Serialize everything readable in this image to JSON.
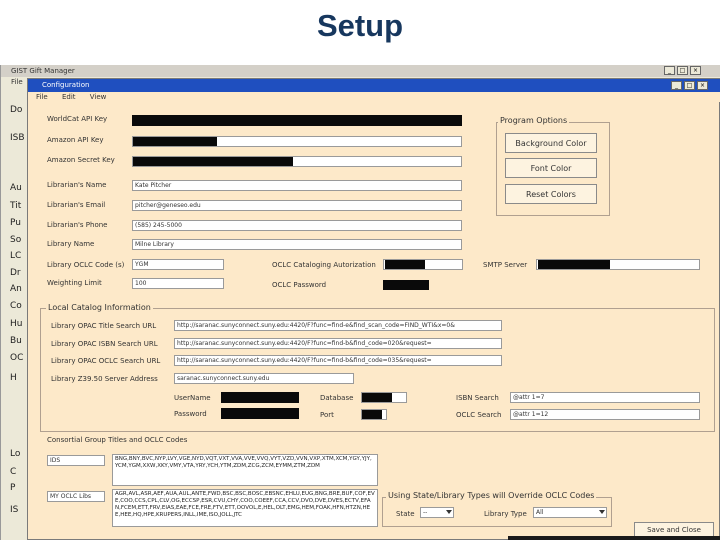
{
  "slide": {
    "title": "Setup"
  },
  "main_window": {
    "title": "GIST Gift Manager",
    "menu": [
      "File"
    ],
    "left_labels": [
      "Do",
      "ISB",
      "Au",
      "Tit",
      "Pu",
      "So",
      "LC",
      "Dr",
      "An",
      "Co",
      "Hu",
      "Bu",
      "OC",
      "H",
      "Lo",
      "C",
      "P",
      "IS"
    ]
  },
  "dialog": {
    "title": "Configuration",
    "menu": [
      "File",
      "Edit",
      "View"
    ],
    "fields": {
      "worldcat_api_key": "WorldCat API Key",
      "amazon_api_key": "Amazon API Key",
      "amazon_secret_key": "Amazon Secret Key",
      "librarian_name_label": "Librarian's Name",
      "librarian_name_value": "Kate Pitcher",
      "librarian_email_label": "Librarian's Email",
      "librarian_email_value": "pitcher@geneseo.edu",
      "librarian_phone_label": "Librarian's Phone",
      "librarian_phone_value": "(585) 245-5000",
      "library_name_label": "Library Name",
      "library_name_value": "Milne Library",
      "oclc_code_label": "Library OCLC Code (s)",
      "oclc_code_value": "YGM",
      "weighting_limit_label": "Weighting Limit",
      "weighting_limit_value": "100",
      "oclc_auth_label": "OCLC Cataloging Autorization",
      "oclc_password_label": "OCLC Password",
      "smtp_server_label": "SMTP Server"
    },
    "program_options": {
      "title": "Program Options",
      "background_color": "Background Color",
      "font_color": "Font Color",
      "reset_colors": "Reset Colors"
    },
    "local_catalog": {
      "title": "Local Catalog Information",
      "title_search_label": "Library OPAC Title Search URL",
      "title_search_value": "http://saranac.sunyconnect.suny.edu:4420/F?func=find-e&find_scan_code=FIND_WTI&x=0&",
      "isbn_search_label": "Library OPAC ISBN Search URL",
      "isbn_search_value": "http://saranac.sunyconnect.suny.edu:4420/F?func=find-b&find_code=020&request=",
      "oclc_search_label": "Library OPAC OCLC Search URL",
      "oclc_search_value": "http://saranac.sunyconnect.suny.edu:4420/F?func=find-b&find_code=035&request=",
      "z3950_label": "Library Z39.50 Server Address",
      "z3950_value": "saranac.sunyconnect.suny.edu",
      "username_label": "UserName",
      "password_label": "Password",
      "database_label": "Database",
      "port_label": "Port",
      "isbn_search_z_label": "ISBN Search",
      "isbn_search_z_value": "@attr 1=7",
      "oclc_search_z_label": "OCLC Search",
      "oclc_search_z_value": "@attr 1=12"
    },
    "consortial": {
      "title": "Consortial Group Titles and OCLC Codes",
      "group1_name": "IDS",
      "group1_codes": "BNG,BNY,BVC,NYP,LVY,VGE,NYD,VQT,VXT,VVA,VVE,VVQ,VYT,VZD,VVN,VXP,XTM,XCM,YGY,YJY,YCM,YGM,XXW,XKY,VMY,VTA,YRY,YCH,YTM,ZDM,ZCG,ZCM,EYMM,ZTM,ZDM",
      "group2_name": "MY OCLC Libs",
      "group2_codes": "AGR,AVL,ASR,AEF,AUA,AUL,ANTE,FWD,BSC,BSC,BOSC,EBSNC,EHLU,EUG,BNG,BRE,BUF,COF,EVE,COO,CCS,CPL,CLV,OG,ECCSP,ESR,CVU,CHY,COO,COEEF,CCA,CCV,DVO,DVE,DVES,ECTV,EFAN,FCEM,ETT,FRV,EIAS,EAE,FCE,FRE,FTV,ETT,OOVOL,E,HEL,OLT,EMG,HEM,FOAK,HFN,HTZN,HEE,HEE,HQ,HPE,KRUPERS,INLL,IME,ISO,JOLL,JTC"
    },
    "state_types": {
      "title": "Using State/Library Types will Override OCLC Codes",
      "state_label": "State",
      "state_value": "--",
      "library_type_label": "Library Type",
      "library_type_value": "All"
    },
    "save_close": "Save and Close"
  }
}
